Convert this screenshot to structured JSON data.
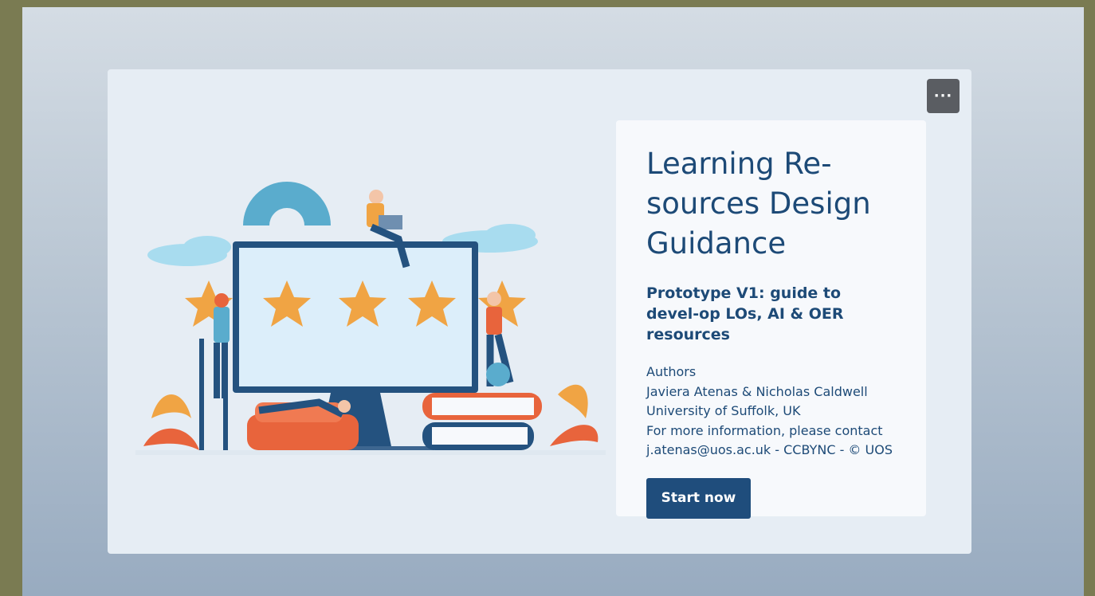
{
  "menu": {
    "icon": "ellipsis-icon",
    "label": "···"
  },
  "intro": {
    "title": "Learning Re-sources Design Guidance",
    "subtitle": "Prototype V1: guide to devel-op LOs, AI & OER resources",
    "details": [
      "Authors",
      "Javiera Atenas & Nicholas Caldwell",
      "University of Suffolk, UK",
      "For more information, please contact",
      "j.atenas@uos.ac.uk - CCBYNC - © UOS"
    ],
    "start_label": "Start now"
  },
  "illustration": {
    "icon": "website-rating-illustration",
    "star_count": 5
  },
  "colors": {
    "outer": "#7a7b52",
    "brand": "#1d4a77",
    "button": "#1f4d7c",
    "star": "#f0a444",
    "accent": "#e8643c"
  }
}
